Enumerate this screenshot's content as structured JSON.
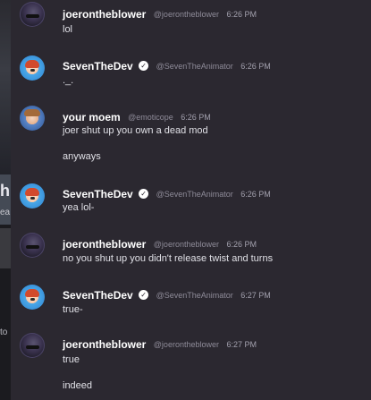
{
  "background_strip": {
    "big_text": "h",
    "small_text": "ea",
    "tiny_text": "to"
  },
  "messages": [
    {
      "user": "joerontheblower",
      "verified": false,
      "handle": "@joerontheblower",
      "time": "6:26 PM",
      "lines": [
        "lol"
      ],
      "avatar": "dark"
    },
    {
      "user": "SevenTheDev",
      "verified": true,
      "handle": "@SevenTheAnimator",
      "time": "6:26 PM",
      "lines": [
        "._."
      ],
      "avatar": "dev"
    },
    {
      "user": "your moem",
      "verified": false,
      "handle": "@emoticope",
      "time": "6:26 PM",
      "lines": [
        "joer shut up you own a dead mod",
        "anyways"
      ],
      "avatar": "moem"
    },
    {
      "user": "SevenTheDev",
      "verified": true,
      "handle": "@SevenTheAnimator",
      "time": "6:26 PM",
      "lines": [
        "yea lol-"
      ],
      "avatar": "dev"
    },
    {
      "user": "joerontheblower",
      "verified": false,
      "handle": "@joerontheblower",
      "time": "6:26 PM",
      "lines": [
        "no you shut up you  didn't release twist and turns"
      ],
      "avatar": "dark"
    },
    {
      "user": "SevenTheDev",
      "verified": true,
      "handle": "@SevenTheAnimator",
      "time": "6:27 PM",
      "lines": [
        "true-"
      ],
      "avatar": "dev"
    },
    {
      "user": "joerontheblower",
      "verified": false,
      "handle": "@joerontheblower",
      "time": "6:27 PM",
      "lines": [
        "true",
        "indeed"
      ],
      "avatar": "dark"
    }
  ],
  "colors": {
    "background": "#2b2830",
    "username": "#ffffff",
    "handle": "#8e8b98",
    "message_text": "#e0e0e6"
  },
  "icons": {
    "verified": "verified-badge-icon"
  }
}
